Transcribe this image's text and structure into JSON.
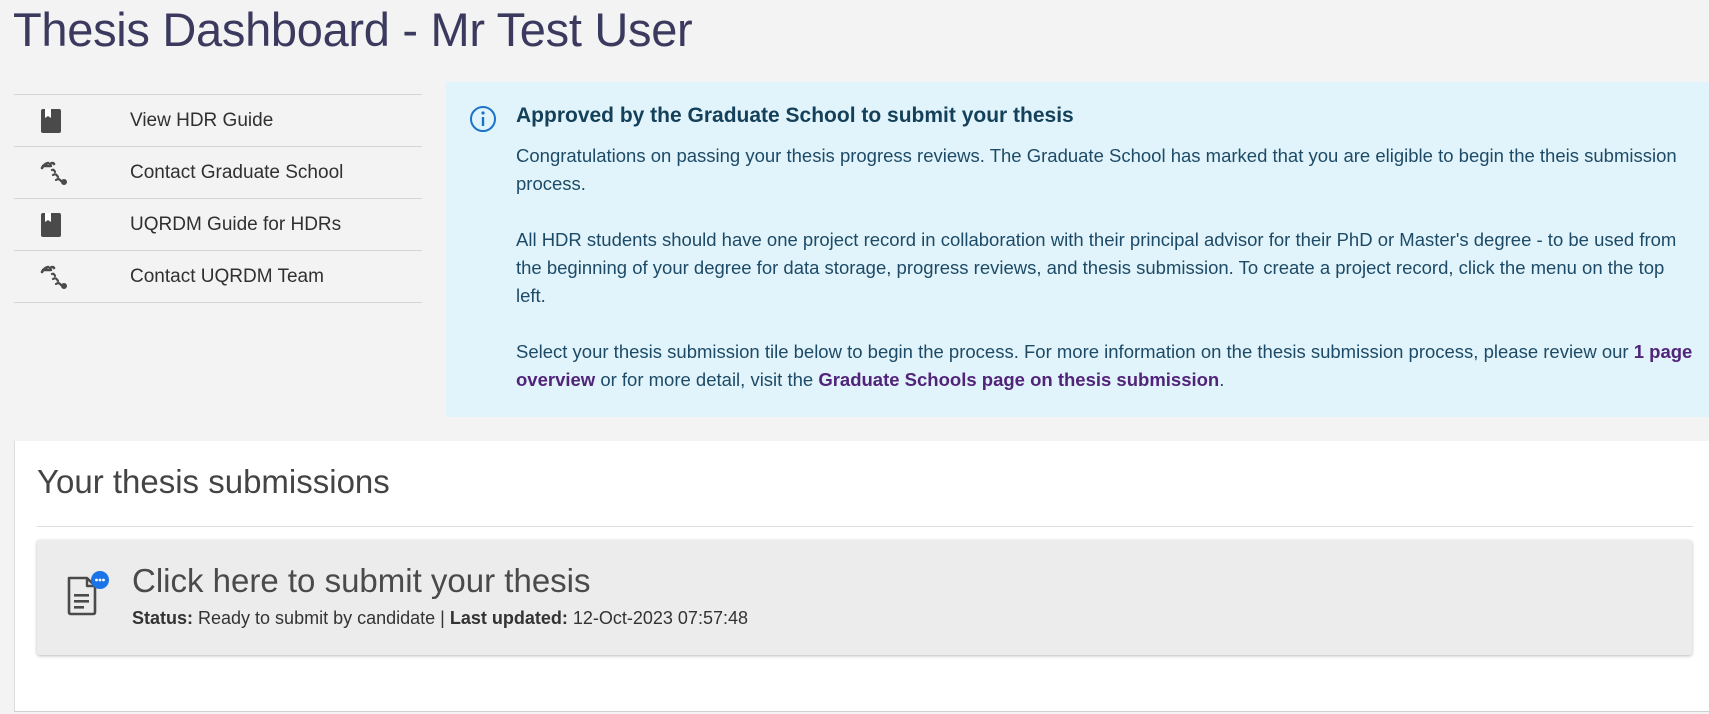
{
  "header": {
    "title": "Thesis Dashboard - Mr Test User"
  },
  "quick_links": [
    {
      "label": "View HDR Guide",
      "icon": "book-icon"
    },
    {
      "label": "Contact Graduate School",
      "icon": "contact-icon"
    },
    {
      "label": "UQRDM Guide for HDRs",
      "icon": "book-icon"
    },
    {
      "label": "Contact UQRDM Team",
      "icon": "contact-icon"
    }
  ],
  "alert": {
    "icon": "info-icon",
    "title": "Approved by the Graduate School to submit your thesis",
    "paragraph1": "Congratulations on passing your thesis progress reviews. The Graduate School has marked that you are eligible to begin the theis submission process.",
    "paragraph2": "All HDR students should have one project record in collaboration with their principal advisor for their PhD or Master's degree - to be used from the beginning of your degree for data storage, progress reviews, and thesis submission. To create a project record, click the menu on the top left.",
    "paragraph3_start": "Select your thesis submission tile below to begin the process. For more information on the thesis submission process, please review our ",
    "link1": "1 page overview",
    "paragraph3_middle": " or for more detail, visit the ",
    "link2": "Graduate Schools page on thesis submission",
    "paragraph3_end": "."
  },
  "submissions": {
    "title": "Your thesis submissions",
    "tile": {
      "icon": "document-notification-icon",
      "title": "Click here to submit your thesis",
      "status_label": "Status:",
      "status_value": " Ready to submit by candidate | ",
      "updated_label": "Last updated:",
      "updated_value": " 12-Oct-2023 07:57:48"
    }
  },
  "colors": {
    "title": "#3b3a5e",
    "alert_bg": "#e1f4fb",
    "alert_text": "#1d4a66",
    "link": "#51247a",
    "info_icon": "#1a73c8",
    "badge": "#1a73e8"
  }
}
